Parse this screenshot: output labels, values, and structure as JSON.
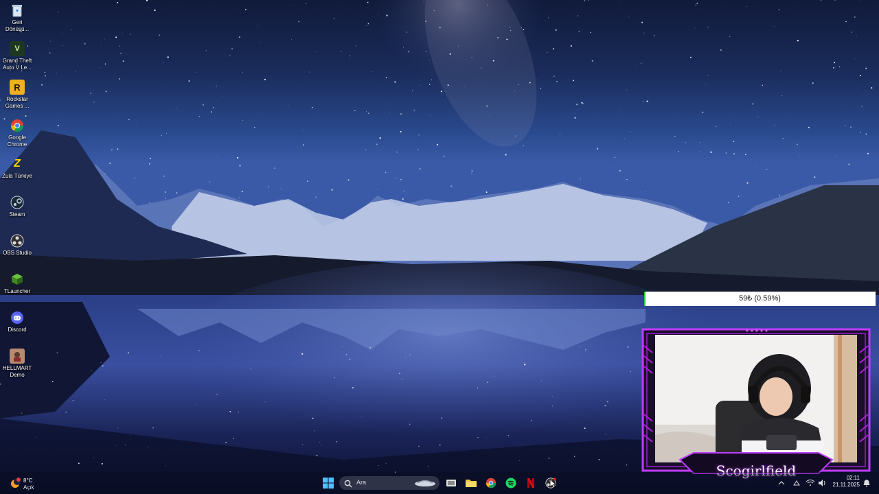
{
  "desktop": {
    "icons": [
      {
        "label": "Geri Dönüşü...",
        "icon": "recycle-bin-icon"
      },
      {
        "label": "Grand Theft Auto V Le...",
        "icon": "gta-v-icon"
      },
      {
        "label": "Rockstar Games ...",
        "icon": "rockstar-icon"
      },
      {
        "label": "Google Chrome",
        "icon": "chrome-icon"
      },
      {
        "label": "Zula Türkiye",
        "icon": "zula-icon"
      },
      {
        "label": "Steam",
        "icon": "steam-icon"
      },
      {
        "label": "OBS Studio",
        "icon": "obs-icon"
      },
      {
        "label": "TLauncher",
        "icon": "tlauncher-icon"
      },
      {
        "label": "Discord",
        "icon": "discord-icon"
      },
      {
        "label": "HELLMART Demo",
        "icon": "hellmart-icon"
      }
    ]
  },
  "overlay": {
    "goal_text": "59₺ (0.59%)",
    "goal_progress_percent": 0.59,
    "streamer_name": "Scogirlfield",
    "frame_color": "#b01ed8"
  },
  "taskbar": {
    "weather": {
      "temp": "8°C",
      "condition": "Açık"
    },
    "search": {
      "placeholder": "Ara"
    },
    "pinned": [
      "windows-start-icon",
      "task-view-icon",
      "file-explorer-icon",
      "chrome-icon",
      "spotify-icon",
      "netflix-icon",
      "obs-icon"
    ],
    "clock": {
      "time": "02:11",
      "date": "21.11.2025"
    }
  }
}
